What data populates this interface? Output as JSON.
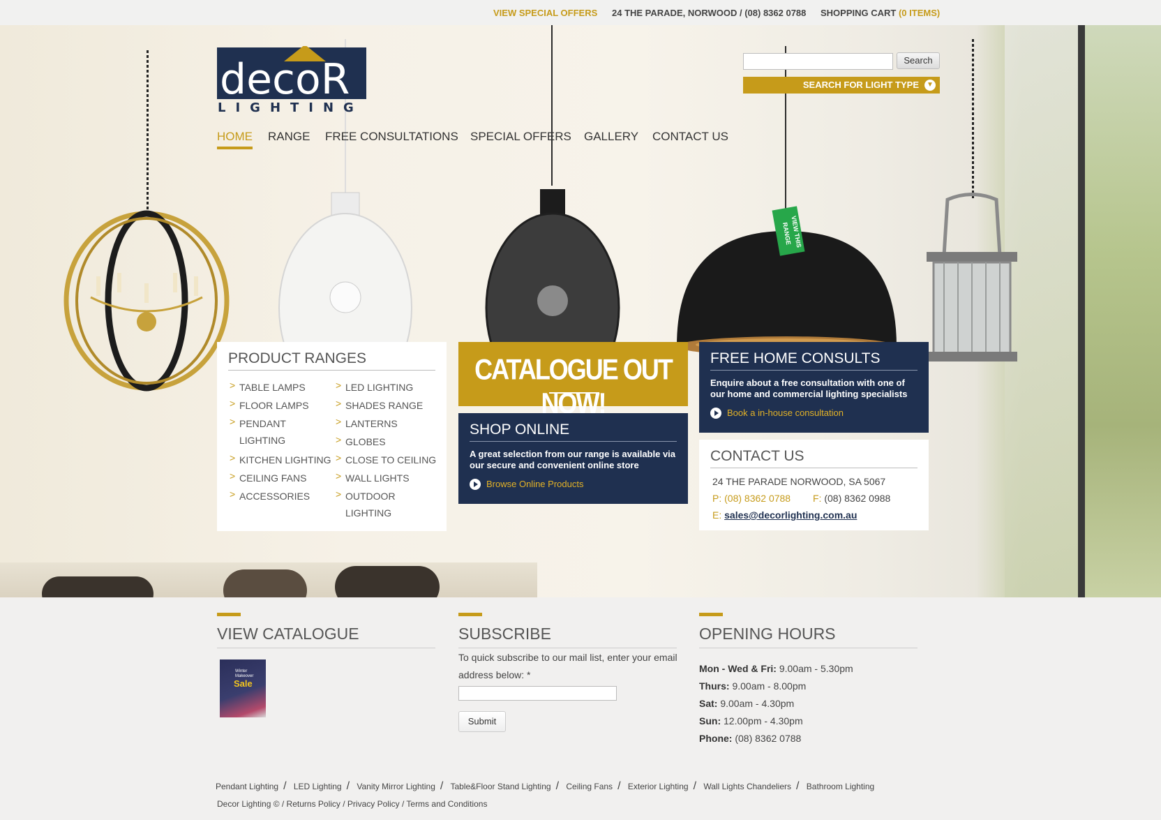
{
  "topbar": {
    "special_offers": "VIEW SPECIAL OFFERS",
    "address_phone": "24 THE PARADE, NORWOOD / (08) 8362 0788",
    "cart_label": "SHOPPING CART",
    "cart_count": "(0 ITEMS)"
  },
  "logo": {
    "text": "decoR",
    "sub": "LIGHTING"
  },
  "search": {
    "button": "Search",
    "placeholder": "",
    "light_type": "SEARCH FOR LIGHT TYPE"
  },
  "nav": [
    "HOME",
    "RANGE",
    "FREE CONSULTATIONS",
    "SPECIAL OFFERS",
    "GALLERY",
    "CONTACT US"
  ],
  "hero": {
    "tag": "VIEW THIS RANGE"
  },
  "product_ranges": {
    "title": "PRODUCT RANGES",
    "col1": [
      "TABLE LAMPS",
      "FLOOR LAMPS",
      "PENDANT",
      "LIGHTING",
      "KITCHEN LIGHTING",
      "CEILING FANS",
      "ACCESSORIES"
    ],
    "col2": [
      "LED LIGHTING",
      "SHADES RANGE",
      "LANTERNS",
      "GLOBES",
      "CLOSE TO CEILING",
      "WALL LIGHTS",
      "OUTDOOR",
      "LIGHTING"
    ]
  },
  "catalogue_banner": "CATALOGUE OUT NOW!",
  "shop_online": {
    "title": "SHOP ONLINE",
    "desc": "A great selection from our range is available via our secure and convenient online store",
    "link": "Browse Online Products"
  },
  "free_consults": {
    "title": "FREE HOME CONSULTS",
    "desc": "Enquire about a free consultation with one of our home and commercial lighting specialists",
    "link": "Book a in-house consultation"
  },
  "contact": {
    "title": "CONTACT US",
    "address": "24 THE PARADE NORWOOD, SA 5067",
    "phone_label": "P:",
    "phone": "(08) 8362 0788",
    "fax_label": "F:",
    "fax": "(08) 8362 0988",
    "email_label": "E:",
    "email": "sales@decorlighting.com.au"
  },
  "view_catalogue": {
    "title": "VIEW CATALOGUE",
    "thumb_text": "Sale",
    "thumb_sub": "Winter Makeover"
  },
  "subscribe": {
    "title": "SUBSCRIBE",
    "desc": "To quick subscribe to our mail list, enter your email address below: *",
    "submit": "Submit"
  },
  "opening_hours": {
    "title": "OPENING HOURS",
    "rows": [
      {
        "day": "Mon - Wed & Fri:",
        "time": "9.00am - 5.30pm"
      },
      {
        "day": "Thurs:",
        "time": "9.00am - 8.00pm"
      },
      {
        "day": "Sat:",
        "time": "9.00am - 4.30pm"
      },
      {
        "day": "Sun:",
        "time": "12.00pm - 4.30pm"
      },
      {
        "day": "Phone:",
        "time": "(08) 8362 0788"
      }
    ]
  },
  "footer": {
    "links": [
      "Pendant Lighting",
      "LED Lighting",
      "Vanity Mirror Lighting",
      "Table&Floor Stand Lighting",
      "Ceiling Fans",
      "Exterior Lighting",
      "Wall Lights Chandeliers",
      "Bathroom Lighting"
    ],
    "copy": "Decor Lighting © / Returns Policy / Privacy Policy / Terms and Conditions"
  },
  "colors": {
    "gold": "#c69b1a",
    "navy": "#1f3050"
  }
}
